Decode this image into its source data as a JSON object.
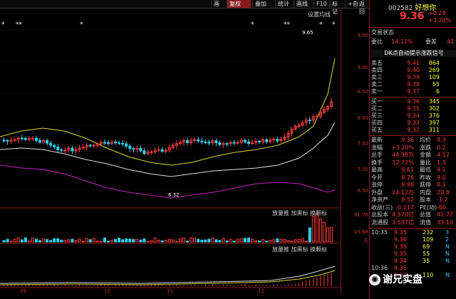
{
  "toolbar": {
    "items": [
      "画",
      "复权",
      "叠加",
      "统计",
      "画线",
      "F10",
      "标记",
      "+自",
      "返回"
    ],
    "active_index": 1
  },
  "chart": {
    "indicator_label": "设置均线",
    "top_marks": [
      "*",
      "**",
      "*",
      "*",
      "**",
      "*",
      "*"
    ],
    "high_label": "9.65",
    "low_label": "6.32",
    "x_labels": [
      "09",
      "10",
      "11",
      "12"
    ],
    "price_ticks": [
      "9.50",
      "9.00",
      "8.50",
      "8.00",
      "7.50",
      "7.00",
      "6.50"
    ],
    "vol_ticks": [
      "91.76",
      "45.88",
      "万"
    ],
    "vol_labels": [
      "放量推",
      "加黑标",
      "换颗标"
    ],
    "macd_labels": [
      "放量推",
      "加黑标",
      "换颗标"
    ]
  },
  "quote": {
    "code": "002582",
    "name": "好想你",
    "price": "9.36",
    "change": "+0.29",
    "change_pct": "+3.20%",
    "status_label": "交易状态",
    "ratio_label": "委比",
    "ratio_value": "14.11%",
    "ratio_label2": "委差",
    "ratio_value2": "42",
    "signal_banner": "DK点自动提示涨跌信号",
    "asks": [
      {
        "label": "卖五",
        "price": "9.41",
        "vol": "864"
      },
      {
        "label": "卖四",
        "price": "9.40",
        "vol": "269"
      },
      {
        "label": "卖三",
        "price": "9.39",
        "vol": "109"
      },
      {
        "label": "卖二",
        "price": "9.38",
        "vol": "55"
      },
      {
        "label": "卖一",
        "price": "9.37",
        "vol": "6"
      }
    ],
    "bids": [
      {
        "label": "买一",
        "price": "9.36",
        "vol": "345"
      },
      {
        "label": "买二",
        "price": "9.35",
        "vol": "302"
      },
      {
        "label": "买三",
        "price": "9.34",
        "vol": "376"
      },
      {
        "label": "买四",
        "price": "9.33",
        "vol": "397"
      },
      {
        "label": "买五",
        "price": "9.32",
        "vol": "311"
      }
    ],
    "stats": [
      {
        "l1": "最新",
        "v1": "9.36",
        "l2": "均价",
        "v2": "9.3"
      },
      {
        "l1": "涨幅",
        "v1": "+3.20%",
        "l2": "涨跌",
        "v2": "0.2"
      },
      {
        "l1": "总手",
        "v1": "44.98万",
        "l2": "金额",
        "v2": "4.12"
      },
      {
        "l1": "换手",
        "v1": "12.72%",
        "l2": "量比",
        "v2": "1.3"
      },
      {
        "l1": "最高",
        "v1": "9.61",
        "l2": "最低",
        "v2": "9.1"
      },
      {
        "l1": "今开",
        "v1": "8.76",
        "l2": "昨收",
        "v2": "9.0"
      },
      {
        "l1": "涨停",
        "v1": "9.98",
        "l2": "跌停",
        "v2": "8.1"
      },
      {
        "l1": "外盘",
        "v1": "24.12万",
        "l2": "内盘",
        "v2": "20.8"
      },
      {
        "l1": "净资产",
        "v1": "9.52",
        "l2": "股本",
        "v2": "-1.2"
      },
      {
        "l1": "收益(三)",
        "v1": "-0.117",
        "l2": "PE(动)",
        "v2": "-60."
      },
      {
        "l1": "总股本",
        "v1": "4.570亿",
        "l2": "总值",
        "v2": "42.77"
      },
      {
        "l1": "流通股",
        "v1": "3.537亿",
        "l2": "流值",
        "v2": "33.10"
      }
    ],
    "ticks": [
      {
        "time": "10:35",
        "price": "9.35",
        "vol": "232",
        "n": "3"
      },
      {
        "time": "",
        "price": "9.36",
        "vol": "109",
        "n": "2"
      },
      {
        "time": "",
        "price": "9.35",
        "vol": "69",
        "n": "N"
      },
      {
        "time": "",
        "price": "9.35",
        "vol": "55",
        "n": "N"
      },
      {
        "time": "",
        "price": "9.34",
        "vol": "35",
        "n": "N"
      },
      {
        "time": "10:36",
        "price": "9.35",
        "vol": "",
        "n": ""
      },
      {
        "time": "",
        "price": "9.33",
        "vol": "110",
        "n": "N"
      }
    ]
  },
  "watermark": "谢兄实盘"
}
